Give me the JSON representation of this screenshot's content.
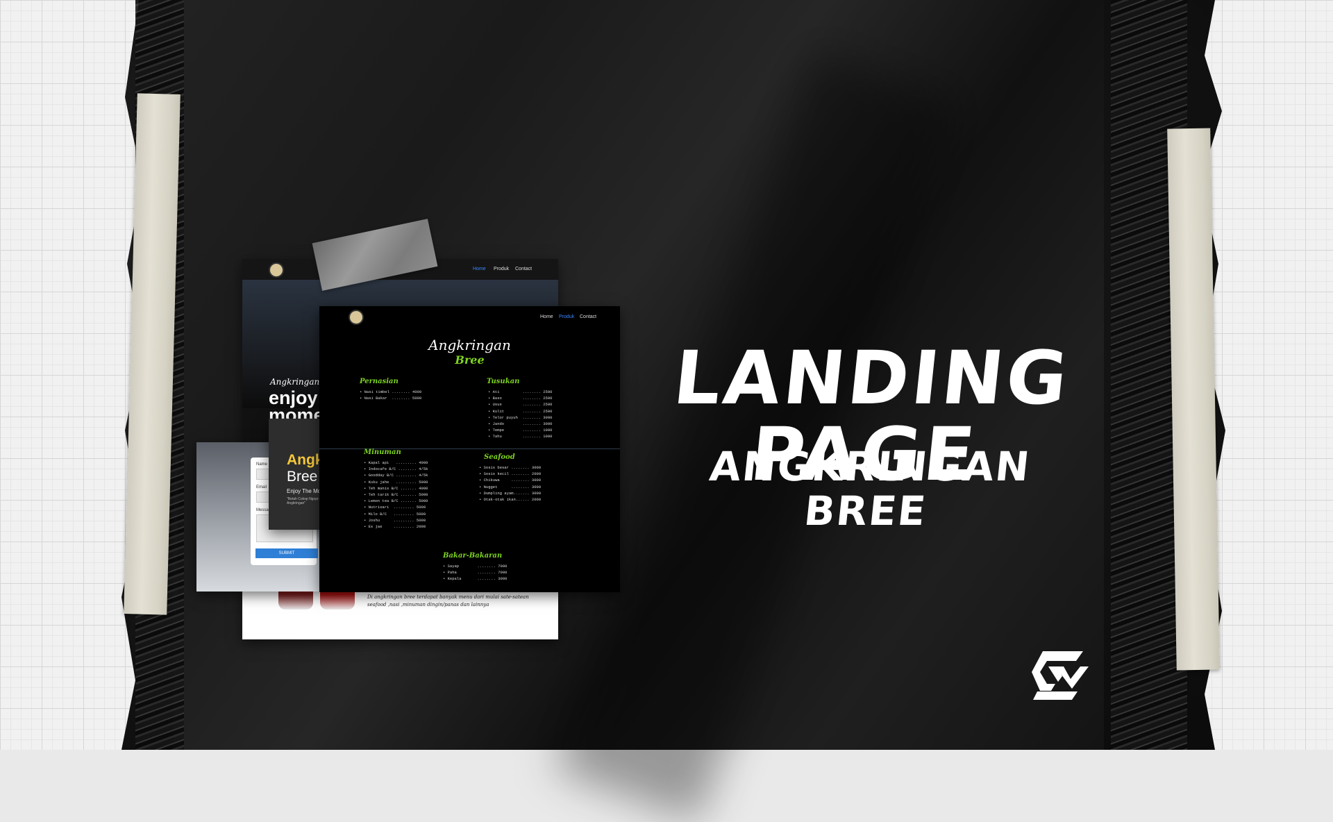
{
  "title": "LANDING PAGE",
  "subtitle": "ANGKRINGAN BREE",
  "mockup_back": {
    "nav": [
      "Home",
      "Produk",
      "Contact"
    ],
    "hero_sub": "Angkringan bre",
    "hero_big_1": "enjoy",
    "hero_big_2": "mome",
    "caption": "Di angkringan bree terdapat banyak menu dari mulai sate-satean seafood ,nasi ,minuman dingin/panas dan lainnya"
  },
  "mockup_form": {
    "labels": [
      "Name",
      "Email",
      "Message"
    ],
    "submit": "SUBMIT"
  },
  "mockup_hero": {
    "title": "Angk",
    "sub": "Bree",
    "enjoy": "Enjoy The Mo",
    "quote": "\"Betah Cokop Ngopi di Angkringan\""
  },
  "menu_page": {
    "nav": [
      "Home",
      "Produk",
      "Contact"
    ],
    "brand_1": "Angkringan",
    "brand_2": "Bree",
    "categories": {
      "pernasian": {
        "name": "Pernasian",
        "items": [
          "• Nasi timbel ........ 4000",
          "• Nasi Bakar  ........ 5000"
        ]
      },
      "tusukan": {
        "name": "Tusukan",
        "items": [
          "• Ati          ........ 2500",
          "• Baso         ........ 2500",
          "• Usus         ........ 2500",
          "• Kulit        ........ 2500",
          "• Telor puyuh  ........ 3000",
          "• Jando        ........ 3000",
          "• Tempe        ........ 1000",
          "• Tahu         ........ 1000"
        ]
      },
      "minuman": {
        "name": "Minuman",
        "items": [
          "• Kapal api   ......... 4000",
          "• Indocafe B/C ........ 4/5k",
          "• Goodday B/C ......... 4/5k",
          "• Kuku jahe   ......... 5000",
          "• Teh manis B/C ....... 4000",
          "• Teh tarik B/C ....... 5000",
          "• Lemon tea B/C ....... 5000",
          "• Nutrisari  ......... 5000",
          "• Milo B/C   ......... 5000",
          "• Joshu      ......... 5000",
          "• Es jae     ......... 2000"
        ]
      },
      "seafood": {
        "name": "Seafood",
        "items": [
          "• Sosis besar ........ 3000",
          "• Sosis kecil ........ 2000",
          "• Chikuwa     ........ 3000",
          "• Nugget      ........ 3000",
          "• Dumpling ayam....... 3000",
          "• Otak-otak ikan...... 2000"
        ]
      },
      "bakar": {
        "name": "Bakar-Bakaran",
        "items": [
          "• Sayap        ........ 7000",
          "• Paha         ........ 7000",
          "• Kepala       ........ 3000"
        ]
      }
    }
  },
  "colors": {
    "accent_green": "#7ed321",
    "accent_yellow": "#f6c93a",
    "link_blue": "#3a86ff"
  },
  "icons": [
    "brand-logo-icon",
    "site-logo-icon"
  ]
}
